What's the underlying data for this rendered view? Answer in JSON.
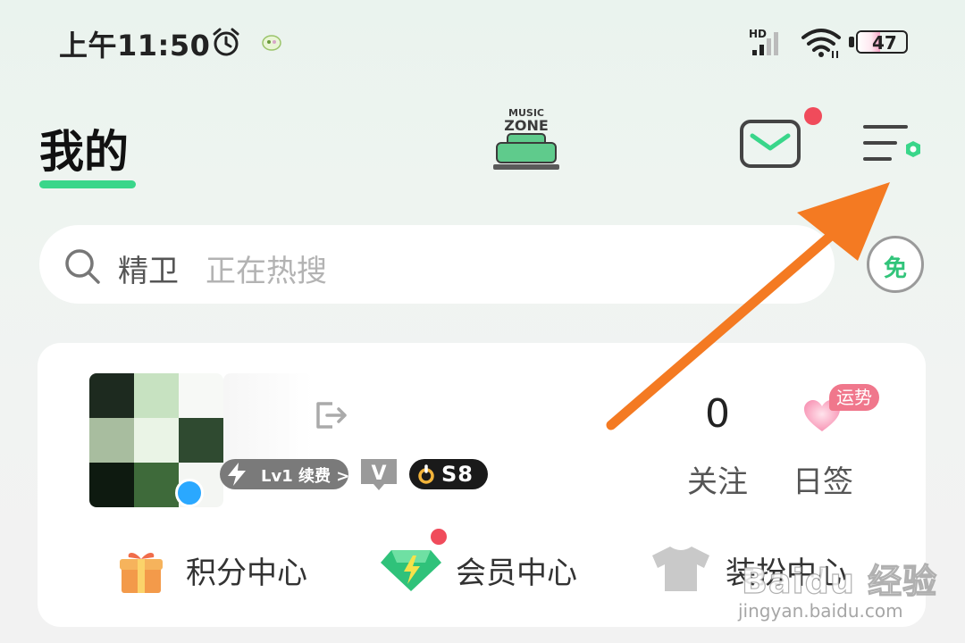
{
  "status_bar": {
    "time": "上午11:50",
    "hd_label": "HD",
    "battery_level": "47",
    "battery_fraction": 0.47
  },
  "header": {
    "title": "我的",
    "logo_text_line1": "MUSIC",
    "logo_text_line2": "ZONE",
    "accent_color": "#39d68a"
  },
  "search": {
    "keyword": "精卫",
    "hint": "正在热搜",
    "free_label": "免"
  },
  "profile": {
    "level_badge": "Lv1 续费 >",
    "v_badge": "V",
    "s8_badge": "S8",
    "follow_count": "0",
    "follow_label": "关注",
    "fortune_tag": "运势",
    "checkin_label": "日签"
  },
  "menu": {
    "points_label": "积分中心",
    "vip_label": "会员中心",
    "dress_label": "装扮中心"
  },
  "watermark": {
    "brand": "Baidu 经验",
    "url": "jingyan.baidu.com"
  },
  "icons": {
    "alarm": "alarm-clock-icon",
    "wifi": "wifi-icon",
    "mail": "mail-icon",
    "menu": "menu-settings-icon",
    "search": "search-icon",
    "logout": "logout-icon",
    "heart": "heart-icon",
    "gift": "gift-icon",
    "diamond": "diamond-icon",
    "shirt": "shirt-icon"
  }
}
